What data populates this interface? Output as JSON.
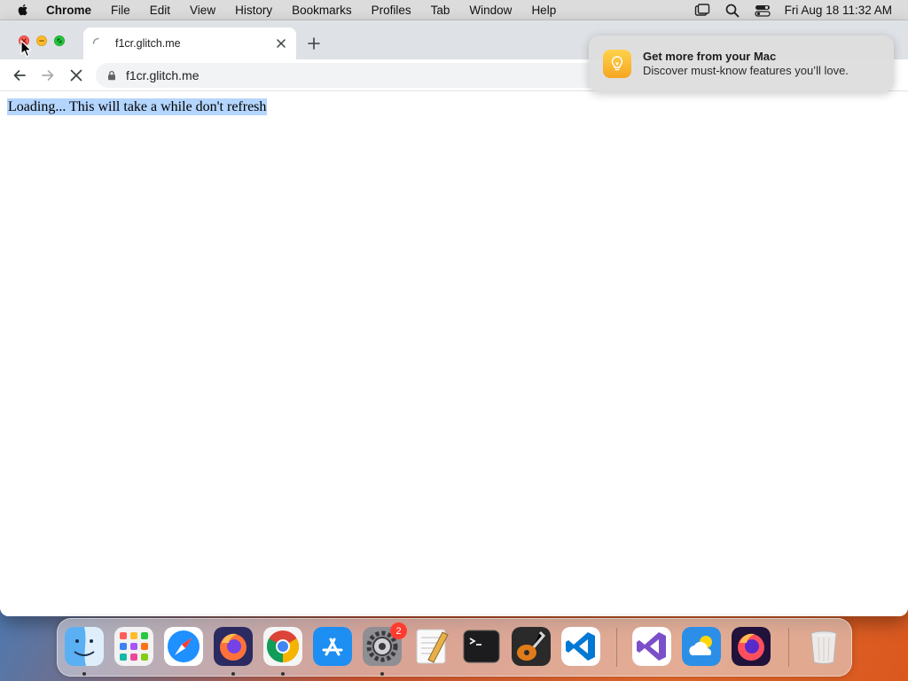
{
  "menubar": {
    "app_name": "Chrome",
    "items": [
      "File",
      "Edit",
      "View",
      "History",
      "Bookmarks",
      "Profiles",
      "Tab",
      "Window",
      "Help"
    ],
    "clock": "Fri Aug 18  11:32 AM"
  },
  "browser": {
    "tab": {
      "title": "f1cr.glitch.me"
    },
    "address_bar": {
      "url": "f1cr.glitch.me"
    }
  },
  "page": {
    "text": "Loading... This will take a while don't refresh"
  },
  "notification": {
    "title": "Get more from your Mac",
    "body": "Discover must-know features you’ll love."
  },
  "dock": {
    "apps": [
      "finder",
      "launchpad",
      "safari",
      "firefox",
      "chrome",
      "app-store",
      "system-settings",
      "textedit",
      "terminal",
      "garageband",
      "vscode",
      "visual-studio",
      "weather",
      "firefox-dev",
      "trash"
    ],
    "system_settings_badge": "2"
  },
  "colors": {
    "selection": "#b4d5fe",
    "tab_strip": "#dee1e6",
    "omnibox": "#f1f3f4"
  }
}
